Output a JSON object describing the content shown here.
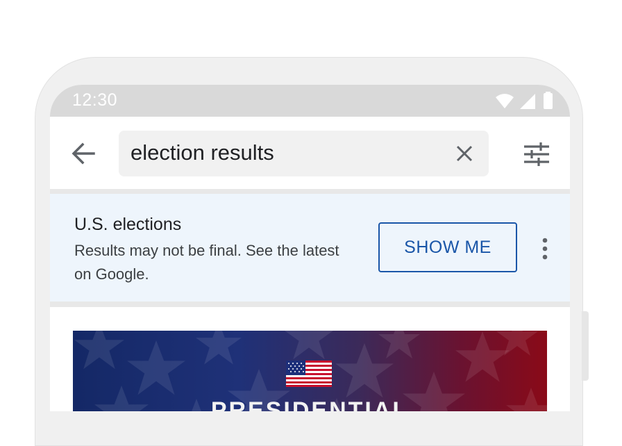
{
  "status_bar": {
    "time": "12:30",
    "icons": [
      "wifi-icon",
      "cell-signal-icon",
      "battery-icon"
    ]
  },
  "search": {
    "query": "election results",
    "icons": [
      "arrow-back-icon",
      "close-icon",
      "tune-icon"
    ]
  },
  "banner": {
    "title": "U.S. elections",
    "text": "Results may not be final. See the latest on Google.",
    "button_label": "SHOW ME",
    "more_icon": "more-vert-icon"
  },
  "hero": {
    "title": "PRESIDENTIAL"
  },
  "colors": {
    "accent": "#1a56a8",
    "banner_background": "#eef5fc",
    "status_bar": "#d9d9d9",
    "search_box": "#f1f1f1"
  }
}
